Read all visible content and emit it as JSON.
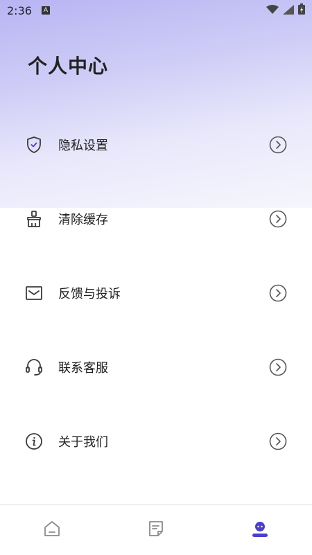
{
  "status_bar": {
    "time": "2:36",
    "notification_badge": "A",
    "icons": [
      "wifi-icon",
      "signal-icon",
      "battery-charging-icon"
    ]
  },
  "page": {
    "title": "个人中心"
  },
  "menu": [
    {
      "label": "隐私设置",
      "icon": "shield-check-icon"
    },
    {
      "label": "清除缓存",
      "icon": "broom-icon"
    },
    {
      "label": "反馈与投诉",
      "icon": "mail-icon"
    },
    {
      "label": "联系客服",
      "icon": "headset-icon"
    },
    {
      "label": "关于我们",
      "icon": "info-icon"
    }
  ],
  "tabbar": [
    {
      "name": "home",
      "icon": "home-icon",
      "active": false
    },
    {
      "name": "notes",
      "icon": "note-icon",
      "active": false
    },
    {
      "name": "profile",
      "icon": "profile-icon",
      "active": true
    }
  ],
  "colors": {
    "accent": "#4b3fd0",
    "icon_dark": "#3a3a3a",
    "gradient_top": "#b7b4f3"
  }
}
